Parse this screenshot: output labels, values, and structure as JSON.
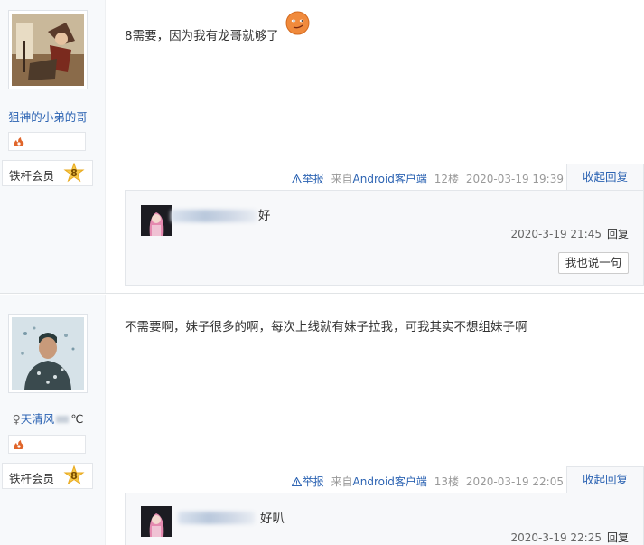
{
  "posts": [
    {
      "user": {
        "name": "狙神的小弟的哥",
        "gender_symbol": "",
        "badge_icon": "fire-badge-icon",
        "level_name": "铁杆会员",
        "level_num": "8"
      },
      "content": "8需要，因为我有龙哥就够了",
      "meta": {
        "report": "举报",
        "source": "来自Android客户端",
        "floor": "12楼",
        "time": "2020-03-19 19:39",
        "collapse": "收起回复"
      },
      "replies": [
        {
          "text": "好",
          "time": "2020-3-19 21:45",
          "reply_label": "回复"
        }
      ],
      "say_button": "我也说一句"
    },
    {
      "user": {
        "name": "天清风",
        "gender_symbol": "♀",
        "name_suffix": "℃",
        "badge_icon": "fire-badge-icon",
        "level_name": "铁杆会员",
        "level_num": "8"
      },
      "content": "不需要啊，妹子很多的啊，每次上线就有妹子拉我，可我其实不想组妹子啊",
      "meta": {
        "report": "举报",
        "source": "来自Android客户端",
        "floor": "13楼",
        "time": "2020-03-19 22:05",
        "collapse": "收起回复"
      },
      "replies": [
        {
          "text": "好叭",
          "time": "2020-3-19 22:25",
          "reply_label": "回复"
        }
      ]
    }
  ],
  "colors": {
    "link": "#2d64b3",
    "sidebar_bg": "#f7f9fb",
    "reply_bg": "#f7f8fa"
  }
}
